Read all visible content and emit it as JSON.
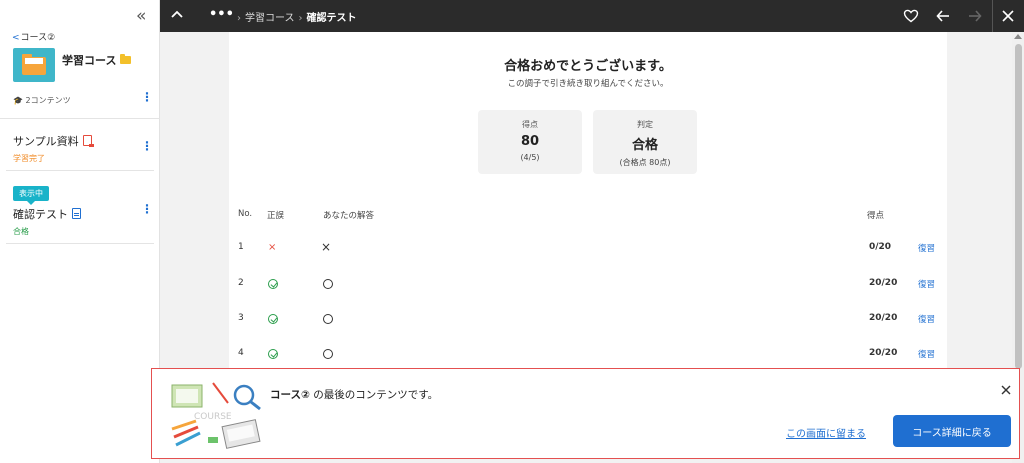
{
  "sidebar": {
    "back_label": "コース②",
    "course_title": "学習コース",
    "content_count": "2コンテンツ",
    "items": [
      {
        "title": "サンプル資料",
        "status": "学習完了",
        "status_color": "#f08a24"
      },
      {
        "title": "確認テスト",
        "status": "合格",
        "status_color": "#2a9d4b",
        "badge": "表示中"
      }
    ]
  },
  "topbar": {
    "dots": "•••",
    "crumb_parent": "学習コース",
    "crumb_current": "確認テスト"
  },
  "result": {
    "heading": "合格おめでとうございます。",
    "subheading": "この調子で引き続き取り組んでください。",
    "score_label": "得点",
    "score_value": "80",
    "score_sub": "(4/5)",
    "judge_label": "判定",
    "judge_value": "合格",
    "judge_sub": "(合格点 80点)"
  },
  "table": {
    "headers": {
      "no": "No.",
      "correct": "正誤",
      "answer": "あなたの解答",
      "score": "得点"
    },
    "rows": [
      {
        "no": "1",
        "result": "×",
        "answer": "×",
        "score": "0/20",
        "action": "復習"
      },
      {
        "no": "2",
        "result": "correct",
        "answer": "○",
        "score": "20/20",
        "action": "復習"
      },
      {
        "no": "3",
        "result": "correct",
        "answer": "○",
        "score": "20/20",
        "action": "復習"
      },
      {
        "no": "4",
        "result": "correct",
        "answer": "○",
        "score": "20/20",
        "action": "復習"
      }
    ]
  },
  "banner": {
    "course_name": "コース②",
    "message": " の最後のコンテンツです。",
    "stay_label": "この画面に留まる",
    "back_label": "コース詳細に戻る",
    "art_caption": "COURSE"
  }
}
